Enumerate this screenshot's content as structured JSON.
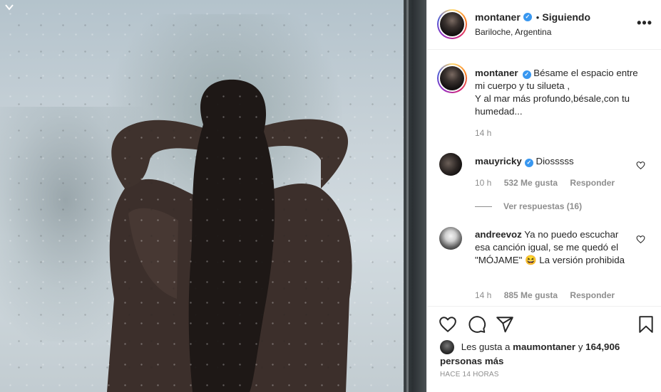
{
  "post": {
    "author": "montaner",
    "follow_separator": "•",
    "follow_status": "Siguiendo",
    "location": "Bariloche, Argentina",
    "more_options": "•••",
    "caption": "Bésame el espacio entre mi cuerpo y tu silueta ,\nY al mar más profundo,bésale,con tu humedad...",
    "caption_time": "14 h"
  },
  "comments": [
    {
      "username": "mauyricky",
      "verified": true,
      "text": "Diosssss",
      "time": "10 h",
      "likes": "532 Me gusta",
      "reply_label": "Responder",
      "view_replies": "Ver respuestas (16)"
    },
    {
      "username": "andreevoz",
      "verified": false,
      "text": "Ya no puedo escuchar esa canción igual, se me quedó el \"MÓJAME\" 😆 La versión prohibida",
      "time": "14 h",
      "likes": "885 Me gusta",
      "reply_label": "Responder"
    }
  ],
  "likes_summary": {
    "prefix": "Les gusta a",
    "first_user": "maumontaner",
    "conjunction": "y",
    "others": "164,906 personas más"
  },
  "timestamp": "HACE 14 HORAS",
  "icons": {
    "verified": "verified-badge-icon",
    "like": "heart-icon",
    "comment": "comment-bubble-icon",
    "share": "paper-plane-icon",
    "save": "bookmark-icon"
  },
  "colors": {
    "verified": "#3897f0",
    "muted_text": "#8e8e8e",
    "primary_text": "#262626"
  }
}
